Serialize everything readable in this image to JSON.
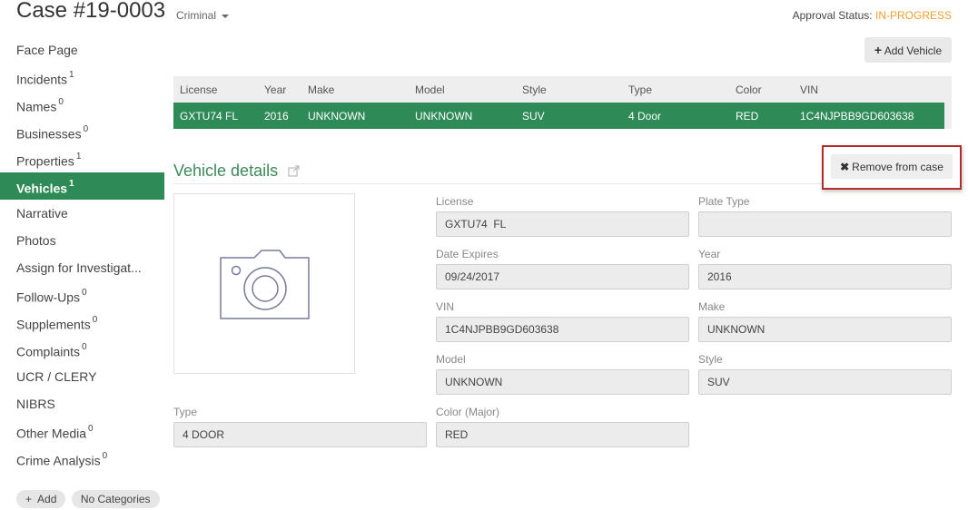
{
  "header": {
    "title": "Case #19-0003",
    "case_type": "Criminal",
    "approval_label": "Approval Status: ",
    "approval_value": "IN-PROGRESS",
    "accent_color": "#f0a030"
  },
  "sidebar": {
    "items": [
      {
        "label": "Face Page",
        "count": ""
      },
      {
        "label": "Incidents",
        "count": "1"
      },
      {
        "label": "Names",
        "count": "0"
      },
      {
        "label": "Businesses",
        "count": "0"
      },
      {
        "label": "Properties",
        "count": "1"
      },
      {
        "label": "Vehicles",
        "count": "1"
      },
      {
        "label": "Narrative",
        "count": ""
      },
      {
        "label": "Photos",
        "count": ""
      },
      {
        "label": "Assign for Investigat...",
        "count": ""
      },
      {
        "label": "Follow-Ups",
        "count": "0"
      },
      {
        "label": "Supplements",
        "count": "0"
      },
      {
        "label": "Complaints",
        "count": "0"
      },
      {
        "label": "UCR / CLERY",
        "count": ""
      },
      {
        "label": "NIBRS",
        "count": ""
      },
      {
        "label": "Other Media",
        "count": "0"
      },
      {
        "label": "Crime Analysis",
        "count": "0"
      }
    ],
    "active_item": "Vehicles",
    "active_color": "#2e8b57",
    "add_label": "Add",
    "categories_label": "No Categories"
  },
  "toolbar": {
    "add_vehicle_label": "Add Vehicle"
  },
  "vehicles_table": {
    "columns": [
      "License",
      "Year",
      "Make",
      "Model",
      "Style",
      "Type",
      "Color",
      "VIN"
    ],
    "rows": [
      [
        "GXTU74 FL",
        "2016",
        "UNKNOWN",
        "UNKNOWN",
        "SUV",
        "4 Door",
        "RED",
        "1C4NJPBB9GD603638"
      ]
    ]
  },
  "details": {
    "title": "Vehicle details",
    "remove_label": "Remove from case",
    "fields": {
      "license": {
        "label": "License",
        "value": "GXTU74  FL"
      },
      "plate_type": {
        "label": "Plate Type",
        "value": ""
      },
      "date_expires": {
        "label": "Date Expires",
        "value": "09/24/2017"
      },
      "year": {
        "label": "Year",
        "value": "2016"
      },
      "vin": {
        "label": "VIN",
        "value": "1C4NJPBB9GD603638"
      },
      "make": {
        "label": "Make",
        "value": "UNKNOWN"
      },
      "model": {
        "label": "Model",
        "value": "UNKNOWN"
      },
      "style": {
        "label": "Style",
        "value": "SUV"
      },
      "type": {
        "label": "Type",
        "value": "4 DOOR"
      },
      "color": {
        "label": "Color (Major)",
        "value": "RED"
      }
    },
    "photo_icon": "camera-icon"
  }
}
